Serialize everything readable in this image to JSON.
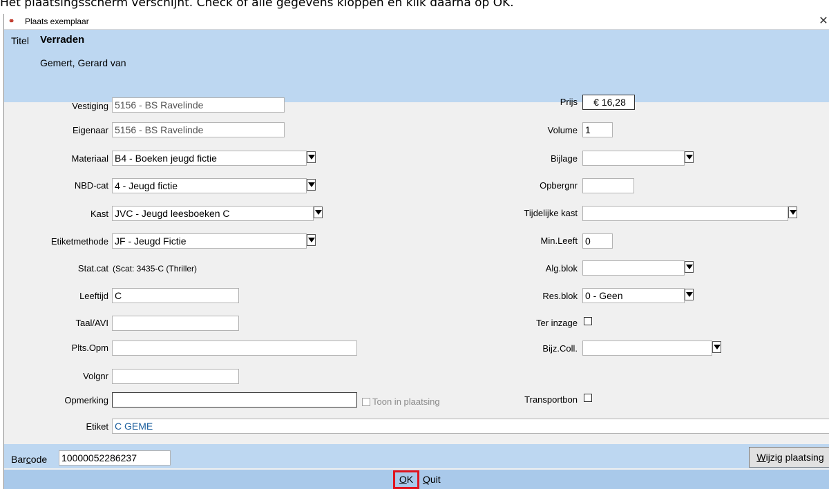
{
  "caption_text": "Het plaatsingsscherm verschijnt. Check of alle gegevens kloppen en klik daarna op OK.",
  "window": {
    "title": "Plaats exemplaar",
    "close_glyph": "✕"
  },
  "header": {
    "title_label": "Titel",
    "title": "Verraden",
    "author": "Gemert, Gerard van"
  },
  "left": {
    "vestiging": {
      "label": "Vestiging",
      "value": "5156 - BS Ravelinde"
    },
    "eigenaar": {
      "label": "Eigenaar",
      "value": "5156 - BS Ravelinde"
    },
    "materiaal": {
      "label": "Materiaal",
      "value": "B4 - Boeken jeugd fictie"
    },
    "nbdcat": {
      "label": "NBD-cat",
      "value": "4 - Jeugd fictie"
    },
    "kast": {
      "label": "Kast",
      "value": "JVC - Jeugd leesboeken C"
    },
    "etiketmethode": {
      "label": "Etiketmethode",
      "value": "JF - Jeugd Fictie"
    },
    "statcat": {
      "label": "Stat.cat",
      "value": "(Scat: 3435-C (Thriller)"
    },
    "leeftijd": {
      "label": "Leeftijd",
      "value": "C"
    },
    "taalavi": {
      "label": "Taal/AVI",
      "value": ""
    },
    "pltsopm": {
      "label": "Plts.Opm",
      "value": ""
    },
    "volgnr": {
      "label": "Volgnr",
      "value": ""
    },
    "opmerking": {
      "label": "Opmerking",
      "value": "",
      "toon_label": "Toon in plaatsing"
    },
    "etiket": {
      "label": "Etiket",
      "value": "C GEME"
    }
  },
  "right": {
    "prijs": {
      "label": "Prijs",
      "value": "€ 16,28"
    },
    "volume": {
      "label": "Volume",
      "value": "1"
    },
    "bijlage": {
      "label": "Bijlage",
      "value": ""
    },
    "opbergnr": {
      "label": "Opbergnr",
      "value": ""
    },
    "tijdelijke_kast": {
      "label": "Tijdelijke kast",
      "value": ""
    },
    "minleeft": {
      "label": "Min.Leeft",
      "value": "0"
    },
    "algblok": {
      "label": "Alg.blok",
      "value": ""
    },
    "resblok": {
      "label": "Res.blok",
      "value": "0 - Geen"
    },
    "terinzage": {
      "label": "Ter inzage"
    },
    "bijzcoll": {
      "label": "Bijz.Coll.",
      "value": ""
    },
    "transportbon": {
      "label": "Transportbon"
    }
  },
  "barcode": {
    "label_pre": "Bar",
    "label_ul": "c",
    "label_post": "ode",
    "value": "10000052286237"
  },
  "buttons": {
    "wijzig_ul": "W",
    "wijzig_rest": "ijzig plaatsing",
    "ok_ul": "O",
    "ok_rest": "K",
    "quit_ul": "Q",
    "quit_rest": "uit"
  },
  "colors": {
    "header_bg": "#bdd7f1",
    "ok_bar_bg": "#a9c9ea",
    "highlight": "#e0141e"
  }
}
